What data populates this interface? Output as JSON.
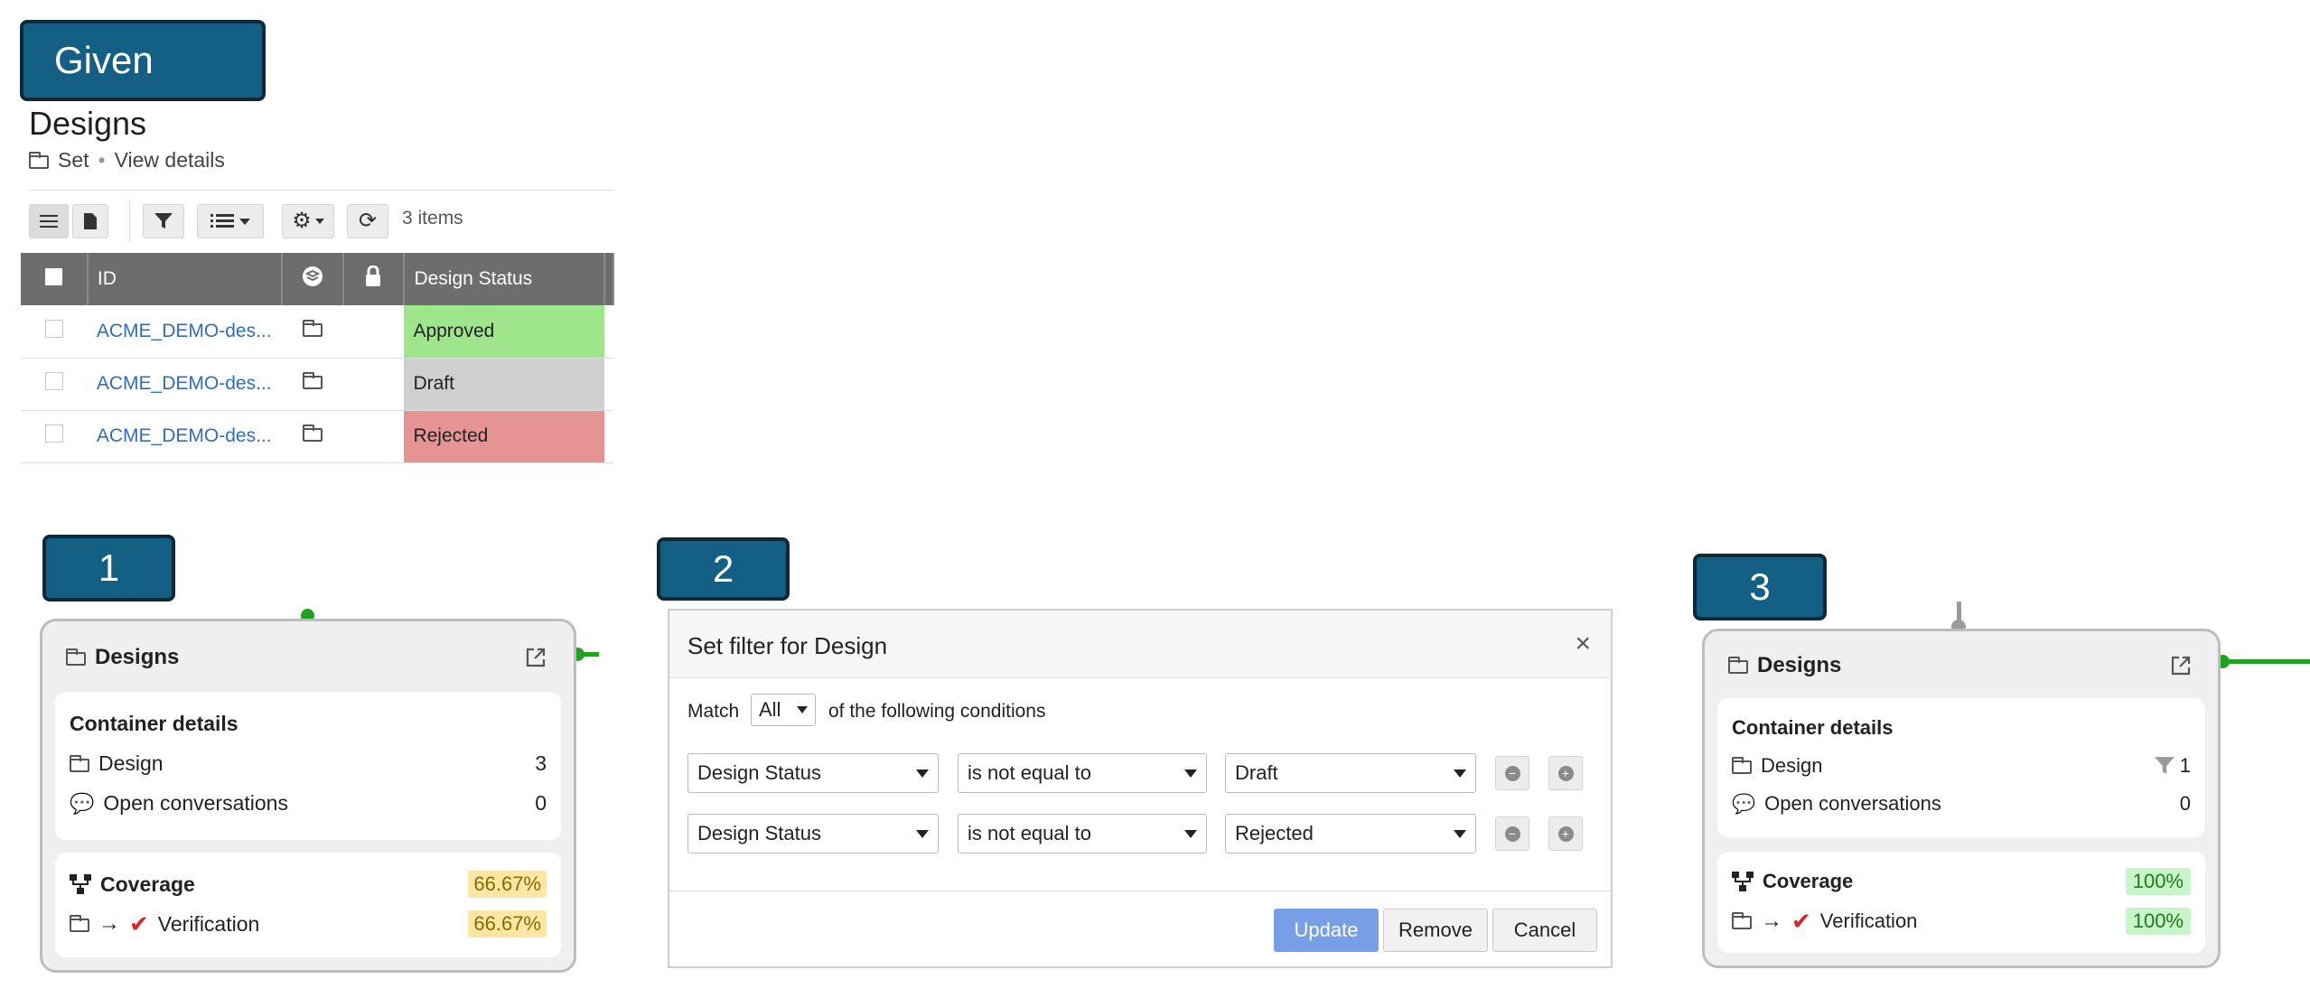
{
  "labels": {
    "given": "Given",
    "step1": "1",
    "step2": "2",
    "step3": "3"
  },
  "given": {
    "title": "Designs",
    "breadcrumb": {
      "set": "Set",
      "separator": "•",
      "view_details": "View details"
    },
    "toolbar": {
      "items_count": "3 items"
    },
    "table": {
      "headers": {
        "id": "ID",
        "status": "Design Status"
      },
      "rows": [
        {
          "id": "ACME_DEMO-des...",
          "status": "Approved",
          "status_color": "#9fe58b"
        },
        {
          "id": "ACME_DEMO-des...",
          "status": "Draft",
          "status_color": "#cfcfcf"
        },
        {
          "id": "ACME_DEMO-des...",
          "status": "Rejected",
          "status_color": "#e69393"
        }
      ]
    }
  },
  "card1": {
    "title": "Designs",
    "section_title": "Container details",
    "rows": [
      {
        "label": "Design",
        "value": "3"
      },
      {
        "label": "Open conversations",
        "value": "0"
      }
    ],
    "coverage_label": "Coverage",
    "coverage_value": "66.67%",
    "verification_label": "Verification",
    "verification_value": "66.67%"
  },
  "dialog": {
    "title": "Set filter for Design",
    "close": "×",
    "match_label": "Match",
    "match_value": "All",
    "match_suffix": "of the following conditions",
    "conditions": [
      {
        "field": "Design Status",
        "operator": "is not equal to",
        "value": "Draft"
      },
      {
        "field": "Design Status",
        "operator": "is not equal to",
        "value": "Rejected"
      }
    ],
    "buttons": {
      "update": "Update",
      "remove": "Remove",
      "cancel": "Cancel"
    }
  },
  "card3": {
    "title": "Designs",
    "section_title": "Container details",
    "rows": [
      {
        "label": "Design",
        "value": "1"
      },
      {
        "label": "Open conversations",
        "value": "0"
      }
    ],
    "coverage_label": "Coverage",
    "coverage_value": "100%",
    "verification_label": "Verification",
    "verification_value": "100%"
  },
  "colors": {
    "label_bg": "#145f84",
    "link": "#2e6dbf",
    "accent_green": "#22a022",
    "update_btn": "#6f9ae6"
  }
}
